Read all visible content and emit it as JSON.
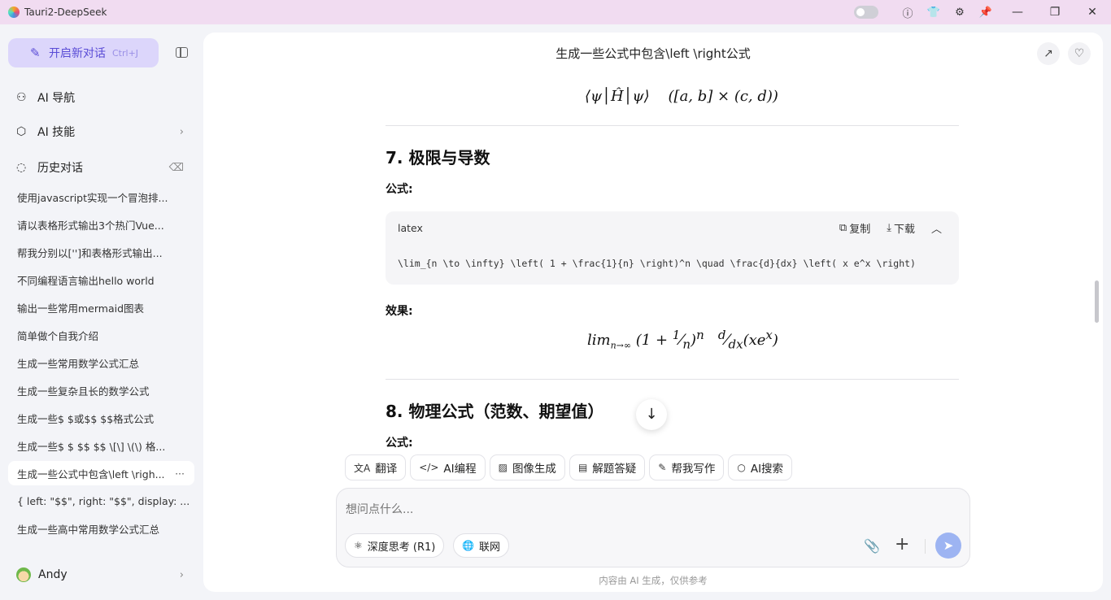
{
  "window": {
    "title": "Tauri2-DeepSeek",
    "icons": [
      "toggle",
      "info-icon",
      "shirt-icon",
      "gear-icon",
      "pin-icon",
      "minimize-icon",
      "restore-icon",
      "close-icon"
    ]
  },
  "sidebar": {
    "new_chat_label": "开启新对话",
    "new_chat_shortcut": "Ctrl+J",
    "nav": [
      {
        "label": "AI 导航"
      },
      {
        "label": "AI 技能"
      },
      {
        "label": "历史对话"
      }
    ],
    "history": [
      "使用javascript实现一个冒泡排...",
      "请以表格形式输出3个热门Vue...",
      "帮我分别以['']和表格形式输出...",
      "不同编程语言输出hello world",
      "输出一些常用mermaid图表",
      "简单做个自我介绍",
      "生成一些常用数学公式汇总",
      "生成一些复杂且长的数学公式",
      "生成一些$ $或$$ $$格式公式",
      "生成一些$ $ $$ $$ \\[\\] \\(\\) 格...",
      "生成一些公式中包含\\left \\righ...",
      "{ left: \"$$\", right: \"$$\", display: ...",
      "生成一些高中常用数学公式汇总"
    ],
    "active_history_index": 10,
    "active_more": "···",
    "user_name": "Andy"
  },
  "main": {
    "title": "生成一些公式中包含\\left \\right公式",
    "section7_title": "7. 极限与导数",
    "formula_label": "公式:",
    "code": {
      "lang": "latex",
      "copy_label": "复制",
      "download_label": "下载",
      "source": "\\lim_{n \\to \\infty} \\left( 1 + \\frac{1}{n} \\right)^n \\quad \\frac{d}{dx} \\left( x e^x \\right)"
    },
    "effect_label": "效果:",
    "section8_title": "8. 物理公式（范数、期望值）",
    "formula_label_2": "公式:"
  },
  "chips": [
    "翻译",
    "AI编程",
    "图像生成",
    "解题答疑",
    "帮我写作",
    "AI搜索"
  ],
  "input": {
    "placeholder": "想问点什么...",
    "deep_think_label": "深度思考 (R1)",
    "web_label": "联网"
  },
  "footer_note": "内容由 AI 生成，仅供参考"
}
